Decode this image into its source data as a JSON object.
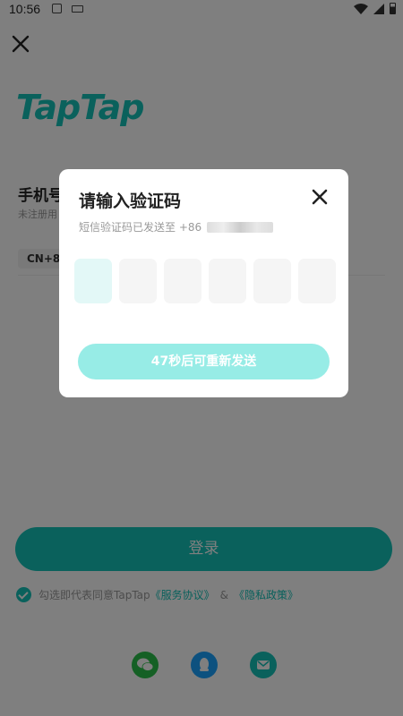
{
  "status_bar": {
    "time": "10:56"
  },
  "login": {
    "logo": "TapTap",
    "phone_title": "手机号",
    "phone_sub": "未注册用",
    "country_code": "CN+86",
    "login_button": "登录",
    "agree_prefix": "勾选即代表同意TapTap",
    "service_link": "《服务协议》",
    "amp": "&",
    "privacy_link": "《隐私政策》"
  },
  "dialog": {
    "title": "请输入验证码",
    "subtitle": "短信验证码已发送至 +86",
    "code_boxes": [
      "",
      "",
      "",
      "",
      "",
      ""
    ],
    "resend_label": "47秒后可重新发送"
  },
  "colors": {
    "accent": "#14c2b8",
    "resend_disabled": "#97ece6"
  }
}
